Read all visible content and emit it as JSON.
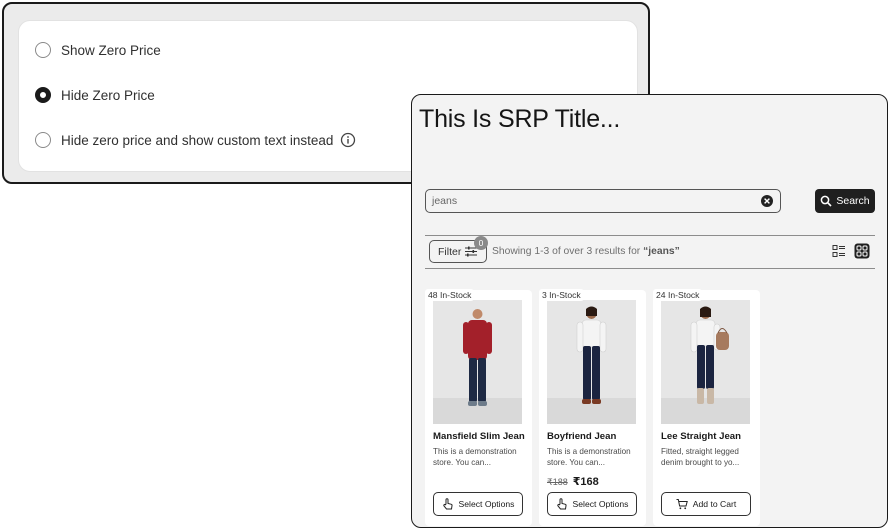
{
  "zero_price_settings": {
    "options": [
      {
        "label": "Show Zero Price",
        "selected": false
      },
      {
        "label": "Hide Zero Price",
        "selected": true
      },
      {
        "label": "Hide zero price and show custom text instead",
        "selected": false,
        "icon": "info-icon"
      }
    ]
  },
  "srp": {
    "title": "This Is SRP Title...",
    "search": {
      "value": "jeans",
      "clear_icon": "clear-icon",
      "button_label": "Search",
      "button_icon": "search-icon"
    },
    "filter": {
      "label": "Filter",
      "icon": "filter-icon",
      "badge_count": "0"
    },
    "results": {
      "prefix": "Showing 1-3 of over 3 results for ",
      "query": "“jeans”"
    },
    "view_toggle": {
      "list_icon": "list-view-icon",
      "grid_icon": "grid-view-icon",
      "active": "grid"
    },
    "products": [
      {
        "stock": "48 In-Stock",
        "name": "Mansfield Slim Jean",
        "description": "This is a demonstration store. You can...",
        "price_old": "",
        "price_new": "",
        "action_label": "Select Options",
        "action_icon": "pointer-hand-icon",
        "shirt_color": "#a3202a"
      },
      {
        "stock": "3 In-Stock",
        "name": "Boyfriend Jean",
        "description": "This is a demonstration store. You can...",
        "price_old": "₹188",
        "price_new": "₹168",
        "action_label": "Select Options",
        "action_icon": "pointer-hand-icon",
        "shirt_color": "#f4f4f4"
      },
      {
        "stock": "24 In-Stock",
        "name": "Lee Straight Jean",
        "description": "Fitted, straight legged denim brought to yo...",
        "price_old": "",
        "price_new": "",
        "action_label": "Add to Cart",
        "action_icon": "cart-icon",
        "shirt_color": "#f4f4f4"
      }
    ]
  }
}
